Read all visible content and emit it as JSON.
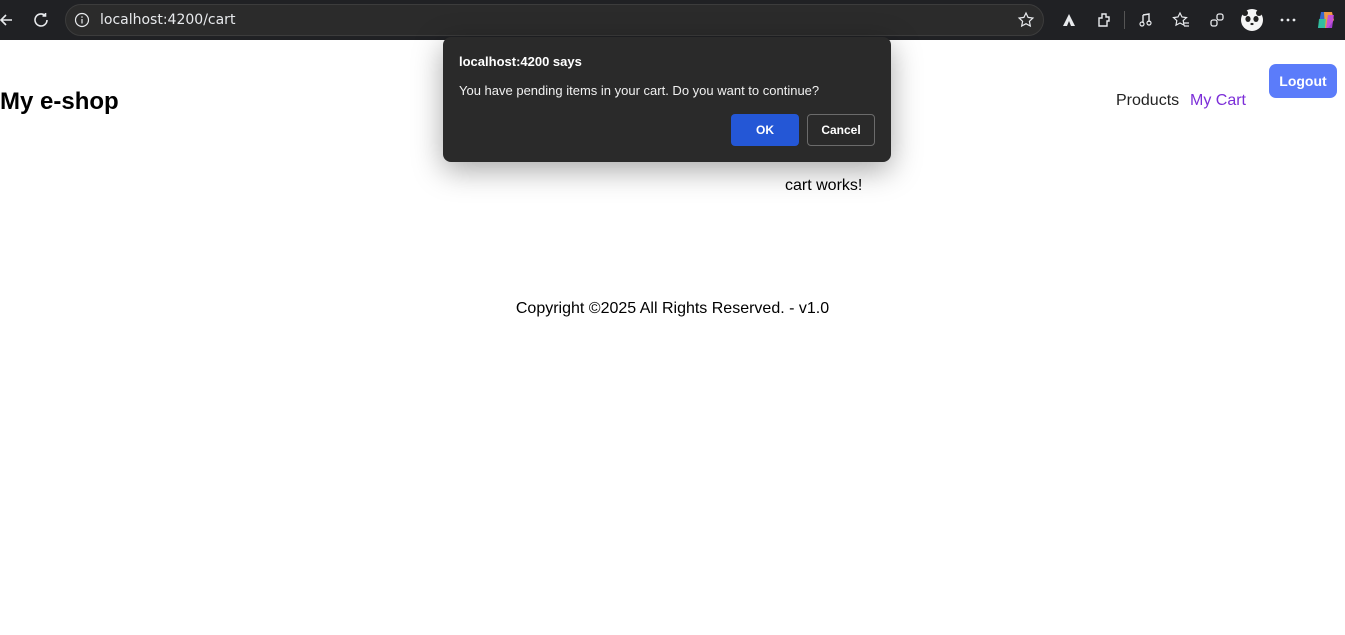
{
  "browser": {
    "url": "localhost:4200/cart",
    "icons": [
      "back-icon",
      "refresh-icon",
      "site-info-icon",
      "favorite-star-icon",
      "adobe-icon",
      "extensions-icon",
      "media-icon",
      "favorites-icon",
      "collections-icon",
      "profile-avatar-icon",
      "more-menu-icon",
      "copilot-icon"
    ]
  },
  "header": {
    "brand": "My e-shop",
    "nav": {
      "products": "Products",
      "my_cart": "My Cart"
    },
    "logout": "Logout"
  },
  "main": {
    "content": "cart works!"
  },
  "footer": {
    "text": "Copyright ©2025 All Rights Reserved. - v1.0"
  },
  "dialog": {
    "title": "localhost:4200 says",
    "message": "You have pending items in your cart. Do you want to continue?",
    "ok": "OK",
    "cancel": "Cancel"
  },
  "colors": {
    "accent": "#5b7cfa",
    "link_active": "#7c2ed8",
    "dialog_ok": "#2457d6"
  }
}
